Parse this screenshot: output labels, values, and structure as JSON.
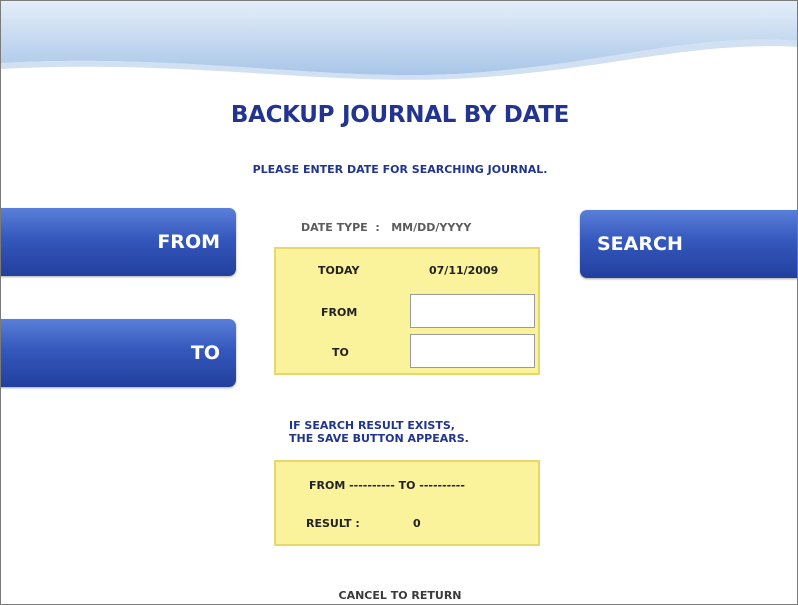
{
  "screen": {
    "title": "BACKUP JOURNAL BY DATE",
    "instruction": "PLEASE ENTER DATE FOR SEARCHING JOURNAL."
  },
  "buttons": {
    "from_label": "FROM",
    "to_label": "TO",
    "search_label": "SEARCH"
  },
  "date_type": "DATE TYPE  :   MM/DD/YYYY",
  "date_panel": {
    "today_label": "TODAY",
    "today_value": "07/11/2009",
    "from_label": "FROM",
    "from_value": "",
    "to_label": "TO",
    "to_value": ""
  },
  "info_text": {
    "line1": "IF SEARCH RESULT EXISTS,",
    "line2": "THE SAVE BUTTON APPEARS."
  },
  "result_panel": {
    "range_text": "FROM ---------- TO ----------",
    "result_label": "RESULT  :",
    "result_value": "0"
  },
  "footer": {
    "cancel_text": "CANCEL TO RETURN"
  },
  "colors": {
    "accent": "#22348e",
    "button": "#3558bd",
    "panel": "#fbf29c"
  }
}
